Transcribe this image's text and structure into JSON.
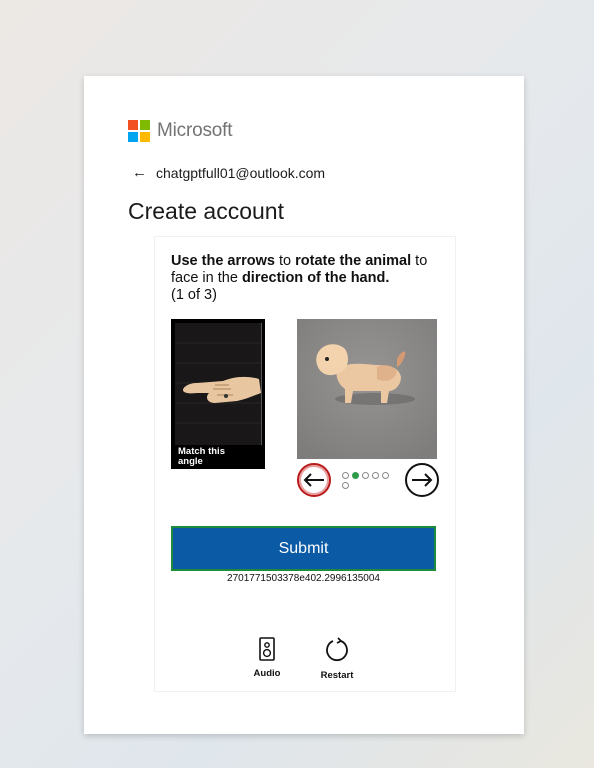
{
  "brand": {
    "name": "Microsoft",
    "logo_colors": [
      "#f25022",
      "#7fba00",
      "#00a4ef",
      "#ffb900"
    ]
  },
  "account": {
    "email": "chatgptfull01@outlook.com",
    "back_icon": "arrow-left-icon"
  },
  "page": {
    "title": "Create account"
  },
  "challenge": {
    "instruction": {
      "p1_bold": "Use the arrows",
      "p2": " to ",
      "p3_bold": "rotate the animal",
      "p4": " to face in the ",
      "p5_bold": "direction of the hand.",
      "p6": " (1 of 3)"
    },
    "reference_caption_line1": "Match this",
    "reference_caption_line2": "angle",
    "position_dots": {
      "total": 5,
      "active": 1
    },
    "submit_label": "Submit",
    "session_id": "2701771503378e402.2996135004",
    "audio_label": "Audio",
    "restart_label": "Restart"
  }
}
